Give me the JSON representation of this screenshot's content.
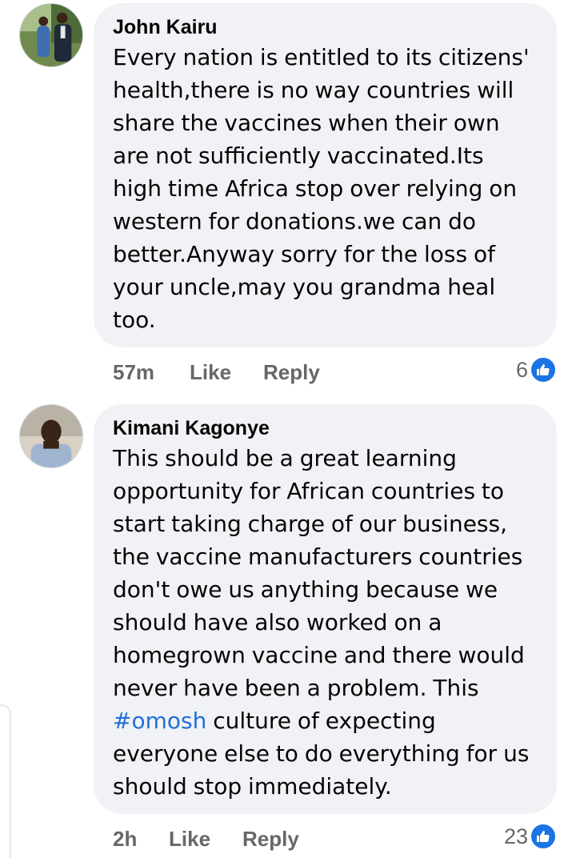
{
  "comments": [
    {
      "author": "John Kairu",
      "lines": [
        "Every nation is entitled to its citizens'",
        "health,there is no way countries will",
        "share the vaccines when their own",
        "are not sufficiently vaccinated.Its",
        "high time Africa stop over relying on",
        "western for donations.we can do",
        "better.Anyway sorry for the loss of",
        "your uncle,may you grandma heal",
        "too."
      ],
      "time": "57m",
      "like_label": "Like",
      "reply_label": "Reply",
      "reaction_count": "6",
      "reaction_icon": "like-thumb-icon"
    },
    {
      "author": "Kimani Kagonye",
      "lines": [
        "This should be a great learning",
        "opportunity for African countries to",
        "start taking charge of our business,",
        "the vaccine manufacturers countries",
        "don't owe us anything because we",
        "should have also worked on a",
        "homegrown vaccine and there would",
        "never have been a problem. This"
      ],
      "hashtag": "#omosh",
      "hashtag_rest": " culture of expecting",
      "lines_after": [
        "everyone else to do everything for us",
        "should stop immediately."
      ],
      "time": "2h",
      "like_label": "Like",
      "reply_label": "Reply",
      "reaction_count": "23",
      "reaction_icon": "like-thumb-icon"
    }
  ],
  "colors": {
    "bubble": "#f0f2f5",
    "meta_text": "#65676b",
    "hashtag": "#216fdb",
    "like_badge": "#1b74e4"
  }
}
